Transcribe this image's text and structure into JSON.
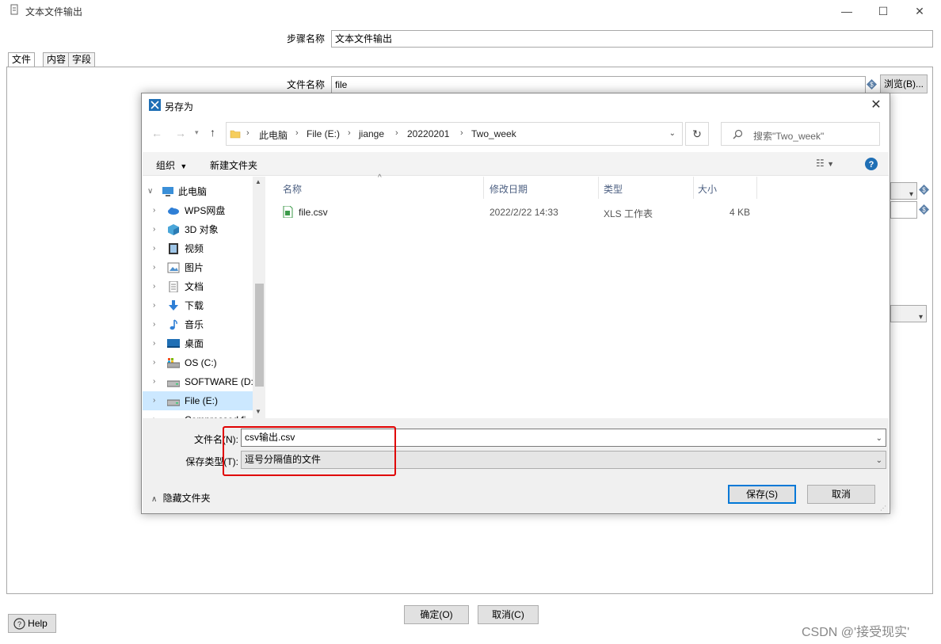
{
  "bg_window": {
    "title": "文本文件输出",
    "step_name_label": "步骤名称",
    "step_name_value": "文本文件输出",
    "tabs": [
      "文件",
      "内容",
      "字段"
    ],
    "filename_label": "文件名称",
    "filename_value": "file",
    "browse_label": "浏览(B)...",
    "ok_label": "确定(O)",
    "cancel_label": "取消(C)",
    "help_label": "Help"
  },
  "dialog": {
    "title": "另存为",
    "breadcrumbs": [
      "此电脑",
      "File (E:)",
      "jiange",
      "20220201",
      "Two_week"
    ],
    "search_placeholder": "搜索\"Two_week\"",
    "organize_label": "组织",
    "new_folder_label": "新建文件夹",
    "nav_items": [
      {
        "label": "此电脑",
        "icon": "computer-icon"
      },
      {
        "label": "WPS网盘",
        "icon": "cloud-icon"
      },
      {
        "label": "3D 对象",
        "icon": "cube-icon"
      },
      {
        "label": "视频",
        "icon": "video-icon"
      },
      {
        "label": "图片",
        "icon": "picture-icon"
      },
      {
        "label": "文档",
        "icon": "document-icon"
      },
      {
        "label": "下载",
        "icon": "download-icon"
      },
      {
        "label": "音乐",
        "icon": "music-icon"
      },
      {
        "label": "桌面",
        "icon": "desktop-icon"
      },
      {
        "label": "OS (C:)",
        "icon": "drive-icon"
      },
      {
        "label": "SOFTWARE (D:",
        "icon": "drive-icon"
      },
      {
        "label": "File (E:)",
        "icon": "drive-icon"
      },
      {
        "label": "Compressed fi",
        "icon": "drive-icon"
      }
    ],
    "columns": [
      "名称",
      "修改日期",
      "类型",
      "大小"
    ],
    "files": [
      {
        "name": "file.csv",
        "modified": "2022/2/22 14:33",
        "type": "XLS 工作表",
        "size": "4 KB"
      }
    ],
    "filename_label": "文件名(N):",
    "filename_value": "csv输出.csv",
    "filetype_label": "保存类型(T):",
    "filetype_value": "逗号分隔值的文件",
    "hide_folders_label": "隐藏文件夹",
    "save_label": "保存(S)",
    "cancel_label": "取消"
  },
  "watermark": "CSDN @'接受现实'",
  "colors": {
    "accent": "#0078d7",
    "highlight": "#e00000",
    "selected": "#cce8ff"
  }
}
